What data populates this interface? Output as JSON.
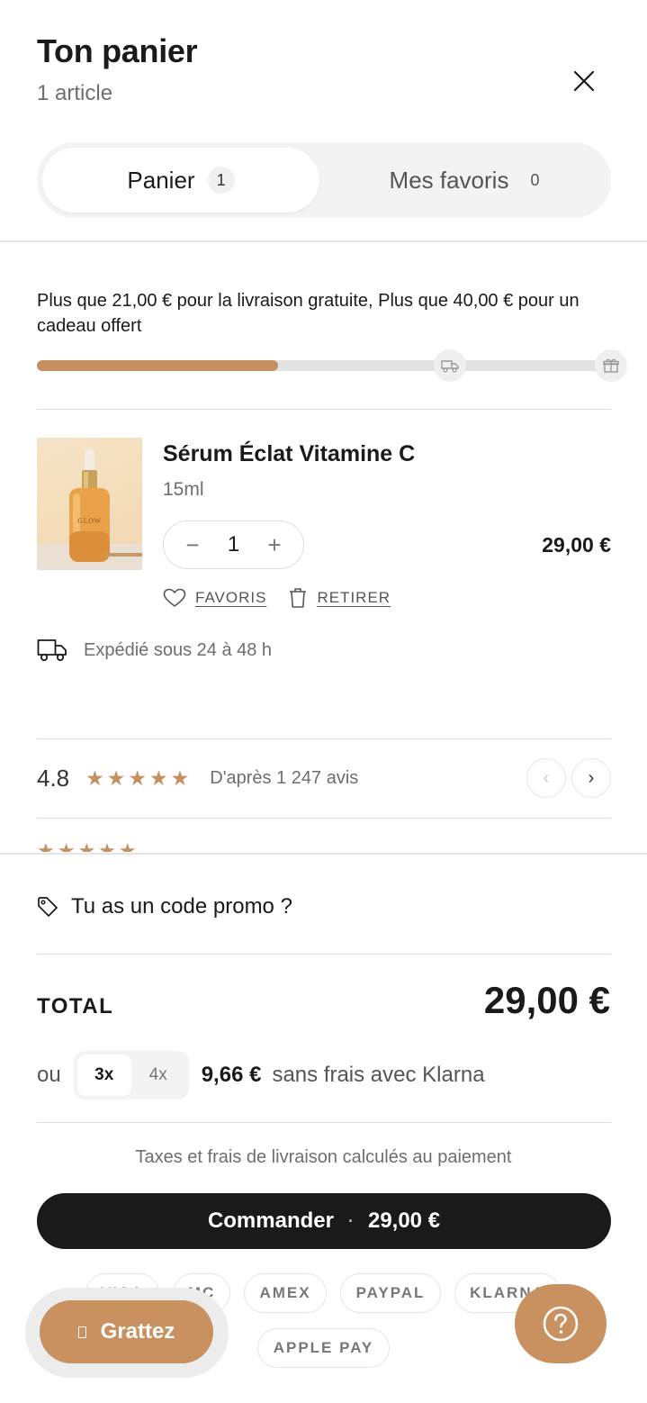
{
  "header": {
    "title": "Ton panier",
    "subtitle": "1 article"
  },
  "tabs": [
    {
      "label": "Panier",
      "count": "1"
    },
    {
      "label": "Mes favoris",
      "count": "0"
    }
  ],
  "shipping": {
    "message": "Plus que 21,00 € pour la livraison gratuite, Plus que 40,00 € pour un cadeau offert",
    "progress_percent": 42,
    "milestones": [
      "truck-icon",
      "gift-icon"
    ]
  },
  "product": {
    "name": "Sérum Éclat Vitamine C",
    "variant": "15ml",
    "image_label": "GLOW",
    "quantity": "1",
    "price": "29,00 €",
    "favorite_label": "FAVORIS",
    "remove_label": "RETIRER"
  },
  "ship_note": "Expédié sous 24 à 48 h",
  "reviews": {
    "rating": "4.8",
    "stars": "★★★★★",
    "count_text": "D'après 1 247 avis"
  },
  "footer": {
    "promo_label": "Tu as un code promo ?",
    "total_label": "TOTAL",
    "total_value": "29,00 €",
    "klarna": {
      "prefix": "ou",
      "options": [
        "3x",
        "4x"
      ],
      "amount": "9,66 €",
      "suffix": "sans frais avec Klarna"
    },
    "taxes_note": "Taxes et frais de livraison calculés au paiement",
    "checkout_label": "Commander",
    "checkout_separator": "·",
    "checkout_amount": "29,00 €",
    "payment_methods": [
      "VISA",
      "MC",
      "AMEX",
      "PAYPAL",
      "KLARNA",
      "APPLE PAY"
    ]
  },
  "floating": {
    "grattez_label": "Grattez"
  },
  "colors": {
    "accent": "#c58f5f",
    "dark": "#1a1a1a",
    "muted": "#6e6e6e"
  }
}
